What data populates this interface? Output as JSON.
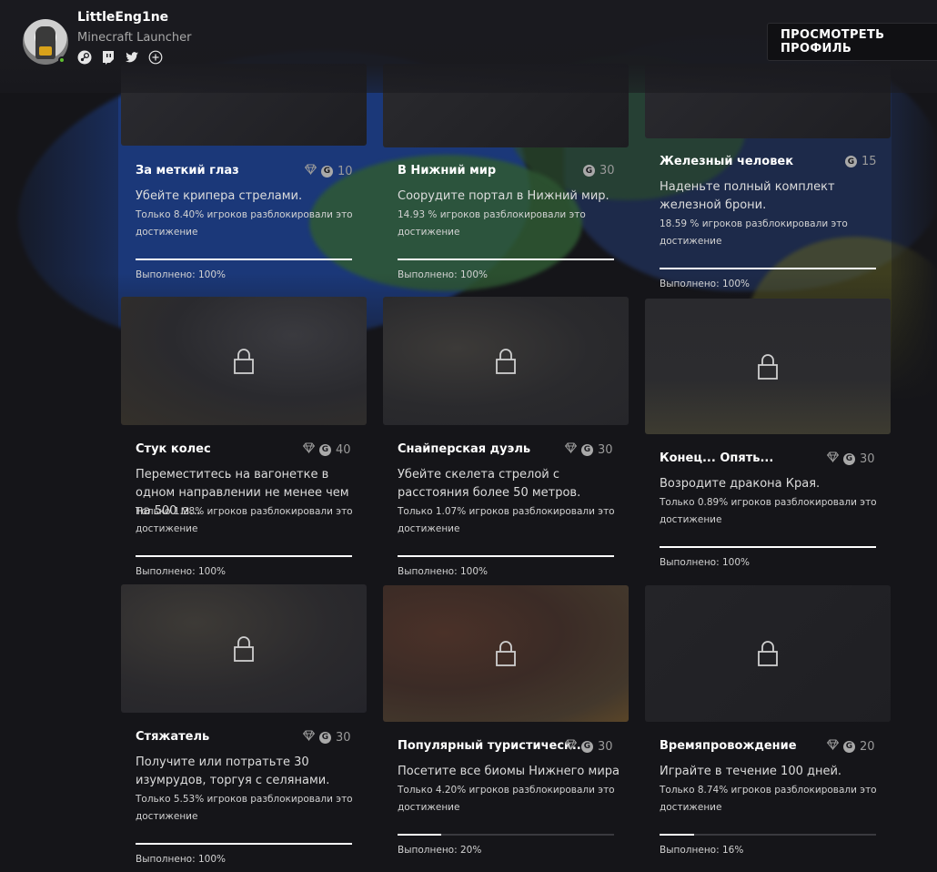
{
  "profile": {
    "name": "LittleEng1ne",
    "platform": "Minecraft Launcher",
    "view_profile_label": "ПРОСМОТРЕТЬ ПРОФИЛЬ",
    "social_icons": [
      "steam-icon",
      "twitch-icon",
      "twitter-icon",
      "add-icon"
    ],
    "status_color": "#5fbf2f"
  },
  "achievements": [
    {
      "title": "За меткий глаз",
      "gem": true,
      "score": "10",
      "desc": "Убейте крипера стрелами.",
      "rarity": "Только 8.40% игроков разблокировали это достижение",
      "progress_label": "Выполнено: 100%",
      "progress": 1.0
    },
    {
      "title": "В Нижний мир",
      "gem": false,
      "score": "30",
      "desc": "Соорудите портал в Нижний мир.",
      "rarity": "14.93 % игроков разблокировали это достижение",
      "progress_label": "Выполнено: 100%",
      "progress": 1.0
    },
    {
      "title": "Железный человек",
      "gem": false,
      "score": "15",
      "desc": "Наденьте полный комплект железной брони.",
      "rarity": "18.59 % игроков разблокировали это достижение",
      "progress_label": "Выполнено: 100%",
      "progress": 1.0
    },
    {
      "title": "Стук колес",
      "gem": true,
      "score": "40",
      "desc": "Переместитесь на вагонетке в одном направлении не менее чем на 500 м...",
      "rarity": "Только 1.28% игроков разблокировали это достижение",
      "progress_label": "Выполнено: 100%",
      "progress": 1.0
    },
    {
      "title": "Снайперская дуэль",
      "gem": true,
      "score": "30",
      "desc": "Убейте скелета стрелой с расстояния более 50 метров.",
      "rarity": "Только 1.07% игроков разблокировали это достижение",
      "progress_label": "Выполнено: 100%",
      "progress": 1.0
    },
    {
      "title": "Конец... Опять...",
      "gem": true,
      "score": "30",
      "desc": "Возродите дракона Края.",
      "rarity": "Только 0.89% игроков разблокировали это достижение",
      "progress_label": "Выполнено: 100%",
      "progress": 1.0
    },
    {
      "title": "Стяжатель",
      "gem": true,
      "score": "30",
      "desc": "Получите или потратьте 30 изумрудов, торгуя с селянами.",
      "rarity": "Только 5.53% игроков разблокировали это достижение",
      "progress_label": "Выполнено: 100%",
      "progress": 1.0
    },
    {
      "title": "Популярный туристическ...",
      "gem": true,
      "score": "30",
      "desc": "Посетите все биомы Нижнего мира",
      "rarity": "Только 4.20% игроков разблокировали это достижение",
      "progress_label": "Выполнено: 20%",
      "progress": 0.2
    },
    {
      "title": "Времяпровождение",
      "gem": true,
      "score": "20",
      "desc": "Играйте в течение 100 дней.",
      "rarity": "Только 8.74% игроков разблокировали это достижение",
      "progress_label": "Выполнено: 16%",
      "progress": 0.16
    }
  ]
}
